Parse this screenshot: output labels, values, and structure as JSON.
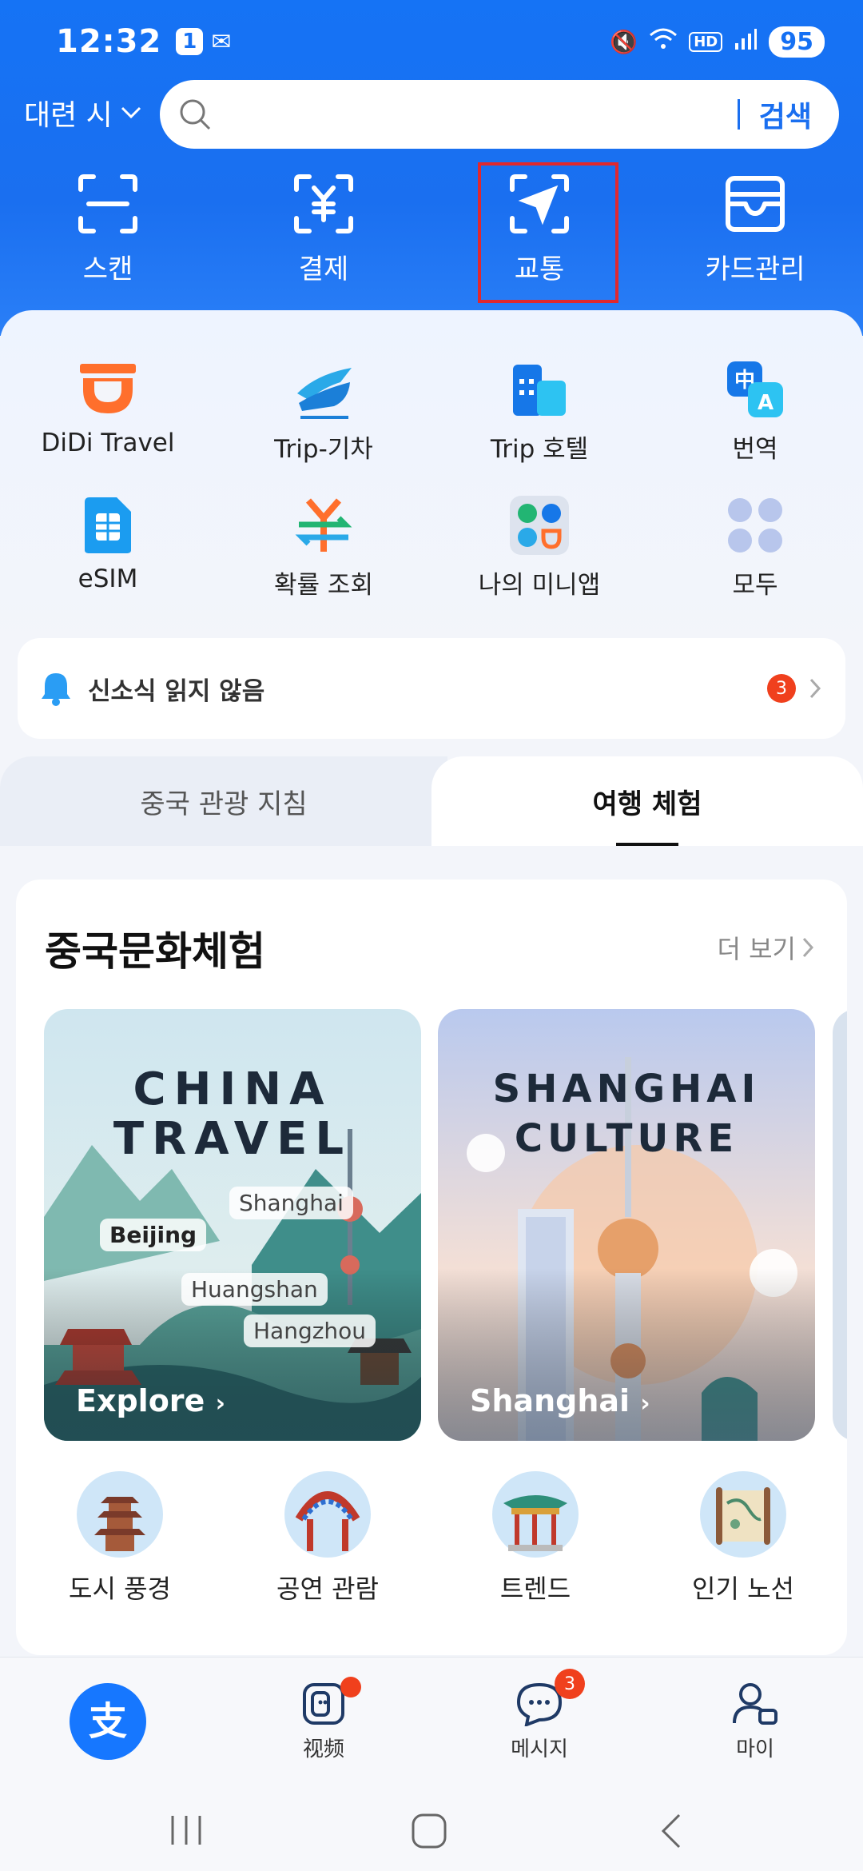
{
  "status": {
    "time": "12:32",
    "notif_badge": "1",
    "battery": "95",
    "hd": "HD"
  },
  "header": {
    "location": "대련 시",
    "search_button": "검색"
  },
  "quick_actions": [
    {
      "label": "스캔",
      "icon": "scan-icon"
    },
    {
      "label": "결제",
      "icon": "yuan-payment-icon"
    },
    {
      "label": "교통",
      "icon": "navigation-arrow-icon",
      "highlighted": true
    },
    {
      "label": "카드관리",
      "icon": "card-wallet-icon"
    }
  ],
  "services": [
    {
      "label": "DiDi Travel",
      "icon": "didi-icon"
    },
    {
      "label": "Trip-기차",
      "icon": "train-icon"
    },
    {
      "label": "Trip 호텔",
      "icon": "hotel-icon"
    },
    {
      "label": "번역",
      "icon": "translate-icon"
    },
    {
      "label": "eSIM",
      "icon": "esim-icon"
    },
    {
      "label": "확률 조회",
      "icon": "exchange-rate-icon"
    },
    {
      "label": "나의 미니앱",
      "icon": "mini-apps-icon"
    },
    {
      "label": "모두",
      "icon": "all-apps-icon"
    }
  ],
  "notice": {
    "text": "신소식 읽지 않음",
    "count": "3"
  },
  "tabs": {
    "left": "중국 관광 지침",
    "right": "여행 체험"
  },
  "section": {
    "title": "중국문화체험",
    "more": "더 보기"
  },
  "banners": [
    {
      "headline_1": "CHINA",
      "headline_2": "TRAVEL",
      "tags": [
        "Beijing",
        "Shanghai",
        "Huangshan",
        "Hangzhou"
      ],
      "cta": "Explore"
    },
    {
      "headline_1": "SHANGHAI",
      "headline_2": "CULTURE",
      "cta": "Shanghai"
    }
  ],
  "categories": [
    {
      "label": "도시 풍경",
      "icon": "pagoda-icon"
    },
    {
      "label": "공연 관람",
      "icon": "opera-mask-icon"
    },
    {
      "label": "트렌드",
      "icon": "pavilion-icon"
    },
    {
      "label": "인기 노선",
      "icon": "map-scroll-icon"
    }
  ],
  "bottom_nav": [
    {
      "label": "",
      "icon": "alipay-logo-icon"
    },
    {
      "label": "视频",
      "icon": "video-icon",
      "dot": true
    },
    {
      "label": "메시지",
      "icon": "message-icon",
      "count": "3"
    },
    {
      "label": "마이",
      "icon": "profile-icon"
    }
  ],
  "colors": {
    "brand_blue": "#1a6ff0",
    "highlight_red": "#e0282e",
    "badge_red": "#f0401d"
  }
}
